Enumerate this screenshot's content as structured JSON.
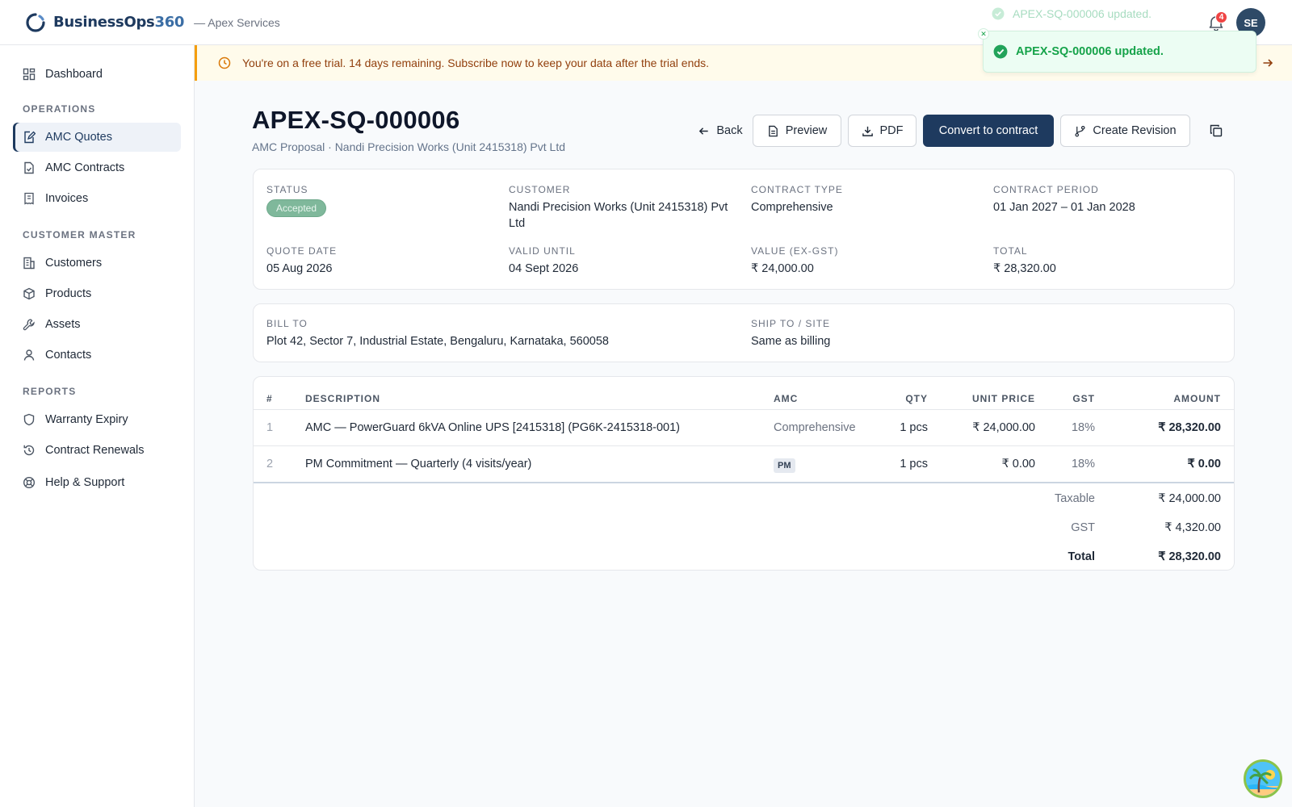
{
  "app": {
    "brand_part1": "BusinessOps",
    "brand_part2": "360",
    "org": "— Apex Services",
    "notifications_count": "4",
    "user_initials": "SE"
  },
  "sidebar": {
    "dashboard": "Dashboard",
    "sections": {
      "operations": "OPERATIONS",
      "customer_master": "CUSTOMER MASTER",
      "reports": "REPORTS"
    },
    "items": {
      "amc_quotes": "AMC Quotes",
      "amc_contracts": "AMC Contracts",
      "invoices": "Invoices",
      "customers": "Customers",
      "products": "Products",
      "assets": "Assets",
      "contacts": "Contacts",
      "warranty_expiry": "Warranty Expiry",
      "contract_renewals": "Contract Renewals",
      "help_support": "Help & Support"
    },
    "active_item": "AMC Quotes"
  },
  "banner": {
    "message": "You're on a free trial. 14 days remaining. Subscribe now to keep your data after the trial ends."
  },
  "toast": {
    "message_faded": "APEX-SQ-000006 updated.",
    "message": "APEX-SQ-000006 updated."
  },
  "header": {
    "title": "APEX-SQ-000006",
    "subtitle": "AMC Proposal · Nandi Precision Works (Unit 2415318) Pvt Ltd",
    "buttons": {
      "back": "Back",
      "preview": "Preview",
      "pdf": "PDF",
      "convert": "Convert to contract",
      "revision": "Create Revision"
    }
  },
  "summary": {
    "status_label": "STATUS",
    "status_value": "Accepted",
    "customer_label": "CUSTOMER",
    "customer_line1": "Nandi Precision Works (Unit 2415318) Pvt",
    "customer_line2": "Ltd",
    "contract_type_label": "CONTRACT TYPE",
    "contract_type_value": "Comprehensive",
    "contract_period_label": "CONTRACT PERIOD",
    "contract_period_value": "01 Jan 2027 – 01 Jan 2028",
    "quote_date_label": "QUOTE DATE",
    "quote_date_value": "05 Aug 2026",
    "valid_until_label": "VALID UNTIL",
    "valid_until_value": "04 Sept 2026",
    "value_label": "VALUE (EX-GST)",
    "value_value": "₹ 24,000.00",
    "total_label": "TOTAL",
    "total_value": "₹ 28,320.00"
  },
  "address": {
    "bill_to_label": "BILL TO",
    "bill_to_value": "Plot 42, Sector 7, Industrial Estate, Bengaluru, Karnataka, 560058",
    "ship_to_label": "SHIP TO / SITE",
    "ship_to_value": "Same as billing"
  },
  "table": {
    "headers": {
      "num": "#",
      "description": "DESCRIPTION",
      "amc": "AMC",
      "qty": "QTY",
      "unit_price": "UNIT PRICE",
      "gst": "GST",
      "amount": "AMOUNT"
    },
    "rows": [
      {
        "num": "1",
        "description": "AMC — PowerGuard 6kVA Online UPS [2415318] (PG6K-2415318-001)",
        "amc": "Comprehensive",
        "qty": "1 pcs",
        "unit_price": "₹ 24,000.00",
        "gst": "18%",
        "amount": "₹ 28,320.00"
      },
      {
        "num": "2",
        "description": "PM Commitment — Quarterly (4 visits/year)",
        "amc": "PM",
        "qty": "1 pcs",
        "unit_price": "₹ 0.00",
        "gst": "18%",
        "amount": "₹ 0.00"
      }
    ],
    "totals": {
      "taxable_label": "Taxable",
      "taxable_value": "₹ 24,000.00",
      "gst_label": "GST",
      "gst_value": "₹ 4,320.00",
      "total_label": "Total",
      "total_value": "₹ 28,320.00"
    }
  }
}
